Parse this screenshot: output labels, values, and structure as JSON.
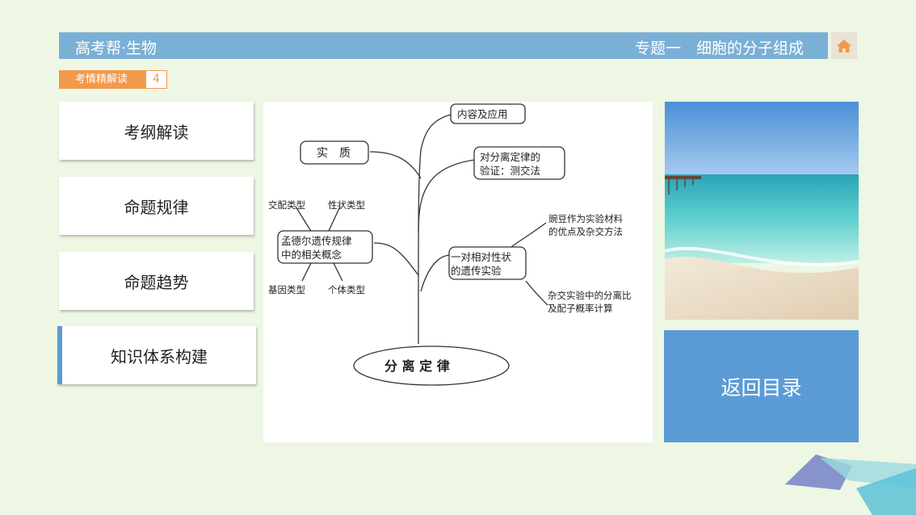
{
  "header": {
    "title_left": "高考帮·生物",
    "title_right": "专题一　细胞的分子组成",
    "home_icon": "home-icon"
  },
  "tag": {
    "label": "考情精解读",
    "number": "4"
  },
  "menu": {
    "items": [
      {
        "label": "考纲解读"
      },
      {
        "label": "命题规律"
      },
      {
        "label": "命题趋势"
      },
      {
        "label": "知识体系构建"
      }
    ]
  },
  "concept_map": {
    "center": "分 离 定 律",
    "content_app": "内容及应用",
    "essence": "实　质",
    "verify_line1": "对分离定律的",
    "verify_line2": "验证：测交法",
    "concepts_line1": "孟德尔遗传规律",
    "concepts_line2": "中的相关概念",
    "hybrid_type": "交配类型",
    "trait_type": "性状类型",
    "gene_type": "基因类型",
    "individual_type": "个体类型",
    "experiment_line1": "一对相对性状",
    "experiment_line2": "的遗传实验",
    "pea_line1": "豌豆作为实验材料",
    "pea_line2": "的优点及杂交方法",
    "ratio_line1": "杂交实验中的分离比",
    "ratio_line2": "及配子概率计算"
  },
  "back_button": {
    "label": "返回目录"
  },
  "colors": {
    "background": "#eef6e4",
    "header": "#7bb0d6",
    "accent_orange": "#f2994a",
    "accent_blue": "#5b9bd5"
  }
}
